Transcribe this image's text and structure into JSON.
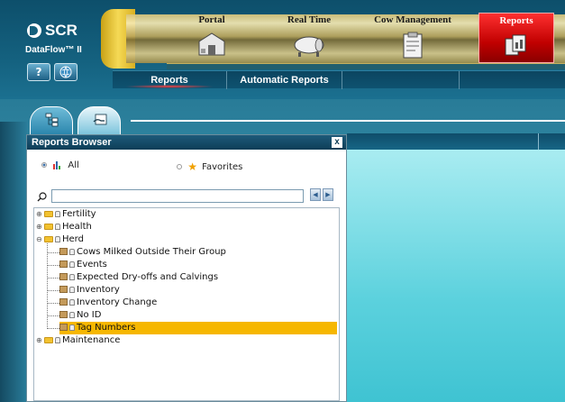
{
  "app": {
    "logo_text": "SCR",
    "product_name": "DataFlow™ II",
    "help_label": "?"
  },
  "nav": {
    "tabs": [
      {
        "label": "Portal",
        "icon": "barn-icon"
      },
      {
        "label": "Real Time",
        "icon": "milk-tank-icon"
      },
      {
        "label": "Cow Management",
        "icon": "clipboard-icon"
      },
      {
        "label": "Reports",
        "icon": "reports-icon",
        "active": true
      }
    ],
    "subtabs": [
      {
        "label": "Reports",
        "active": true
      },
      {
        "label": "Automatic Reports"
      }
    ]
  },
  "reports_browser": {
    "title": "Reports Browser",
    "close_label": "x",
    "filter": {
      "all_label": "All",
      "favorites_label": "Favorites",
      "selected": "All"
    },
    "search": {
      "value": "",
      "placeholder": ""
    },
    "tree": [
      {
        "label": "Fertility",
        "expanded": false
      },
      {
        "label": "Health",
        "expanded": false
      },
      {
        "label": "Herd",
        "expanded": true,
        "children": [
          {
            "label": "Cows Milked Outside Their Group"
          },
          {
            "label": "Events"
          },
          {
            "label": "Expected Dry-offs and Calvings"
          },
          {
            "label": "Inventory"
          },
          {
            "label": "Inventory Change"
          },
          {
            "label": "No ID"
          },
          {
            "label": "Tag Numbers",
            "selected": true
          }
        ]
      },
      {
        "label": "Maintenance",
        "expanded": false
      }
    ]
  },
  "colors": {
    "accent_red": "#d00000",
    "selection": "#f6b700",
    "header_blue": "#0e4f6c"
  }
}
